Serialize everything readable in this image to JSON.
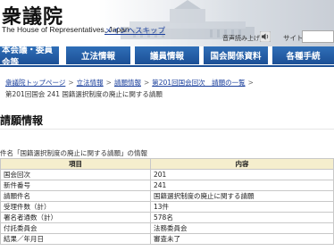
{
  "header": {
    "logo": "衆議院",
    "subtitle": "The House of Representatives, Japan",
    "skip_link": "メインへスキップ",
    "speech_label": "音声読み上げ",
    "site_label": "サイト"
  },
  "nav": {
    "items": [
      {
        "label": "本会議・委員会等"
      },
      {
        "label": "立法情報"
      },
      {
        "label": "議員情報"
      },
      {
        "label": "国会関係資料"
      },
      {
        "label": "各種手続"
      }
    ]
  },
  "breadcrumb": {
    "items": [
      {
        "label": "衆議院トップページ"
      },
      {
        "label": "立法情報"
      },
      {
        "label": "請願情報"
      },
      {
        "label": "第201回国会回次　請願の一覧"
      }
    ],
    "separator": ">",
    "current": "第201回国会 241 国籍選択制度の廃止に関する請願"
  },
  "section_title": "請願情報",
  "table": {
    "caption": "件名「国籍選択制度の廃止に関する請願」の情報",
    "headers": [
      "項目",
      "内容"
    ],
    "rows": [
      {
        "key": "国会回次",
        "value": "201"
      },
      {
        "key": "新件番号",
        "value": "241"
      },
      {
        "key": "請願件名",
        "value": "国籍選択制度の廃止に関する請願"
      },
      {
        "key": "受理件数（計）",
        "value": "13件"
      },
      {
        "key": "署名者通数（計）",
        "value": "578名"
      },
      {
        "key": "付託委員会",
        "value": "法務委員会"
      },
      {
        "key": "結果／年月日",
        "value": "審査未了"
      }
    ]
  }
}
